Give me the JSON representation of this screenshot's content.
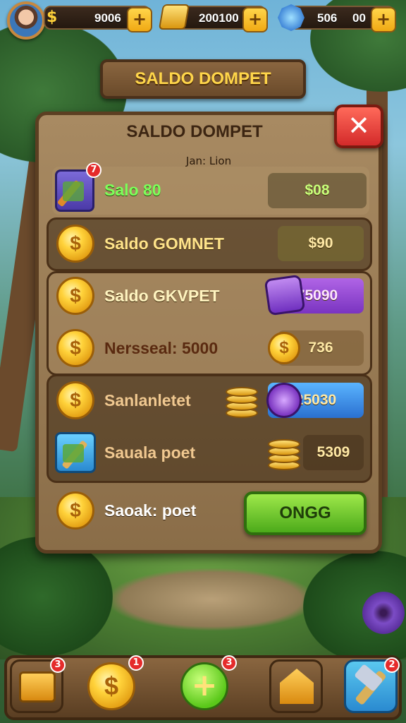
{
  "top_bar": {
    "currency_1": {
      "icon": "dollar-icon",
      "value": "9006",
      "plus": "+"
    },
    "currency_2": {
      "icon": "gold-bars-icon",
      "value": "200100",
      "plus": "+"
    },
    "currency_3": {
      "icon": "gem-icon",
      "value": "506",
      "value_2": "00",
      "plus": "+"
    }
  },
  "header": {
    "title": "SALDO DOMPET"
  },
  "panel": {
    "title": "SALDO DOMPET",
    "subtitle": "Jan: Lion",
    "close": "✕",
    "rows": [
      {
        "label": "Salo 80",
        "value": "$08",
        "icon": "sword-card-icon",
        "badge": "7"
      },
      {
        "label": "Saldo GOMNET",
        "value": "$90",
        "icon": "coin-icon"
      },
      {
        "label": "Saldo GKVPET",
        "value": "75090",
        "icon": "coin-icon",
        "gem": "purple-gem-icon"
      },
      {
        "label": "Nersseal: 5000",
        "value": "736",
        "icon": "coin-icon"
      },
      {
        "label": "Sanlanletet",
        "value": "25030",
        "icon": "coin-icon",
        "gem": "purple-orb-icon"
      },
      {
        "label": "Sauala poet",
        "value": "5309",
        "icon": "sword-card-icon"
      },
      {
        "label": "Saoak: poet",
        "icon": "coin-icon"
      }
    ],
    "ok_button": "ONGG"
  },
  "bottom_bar": {
    "items": [
      {
        "name": "chest",
        "icon": "treasure-chest-icon",
        "badge": "3"
      },
      {
        "name": "coin",
        "icon": "coin-icon",
        "badge": "1"
      },
      {
        "name": "add",
        "icon": "plus-icon",
        "badge": "3"
      },
      {
        "name": "home",
        "icon": "house-icon"
      },
      {
        "name": "craft",
        "icon": "hammer-icon",
        "badge": "2"
      }
    ]
  },
  "colors": {
    "accent_gold": "#ffd64a",
    "panel_brown": "#8a6d48",
    "close_red": "#d32a2a",
    "ok_green": "#4caa1a"
  }
}
